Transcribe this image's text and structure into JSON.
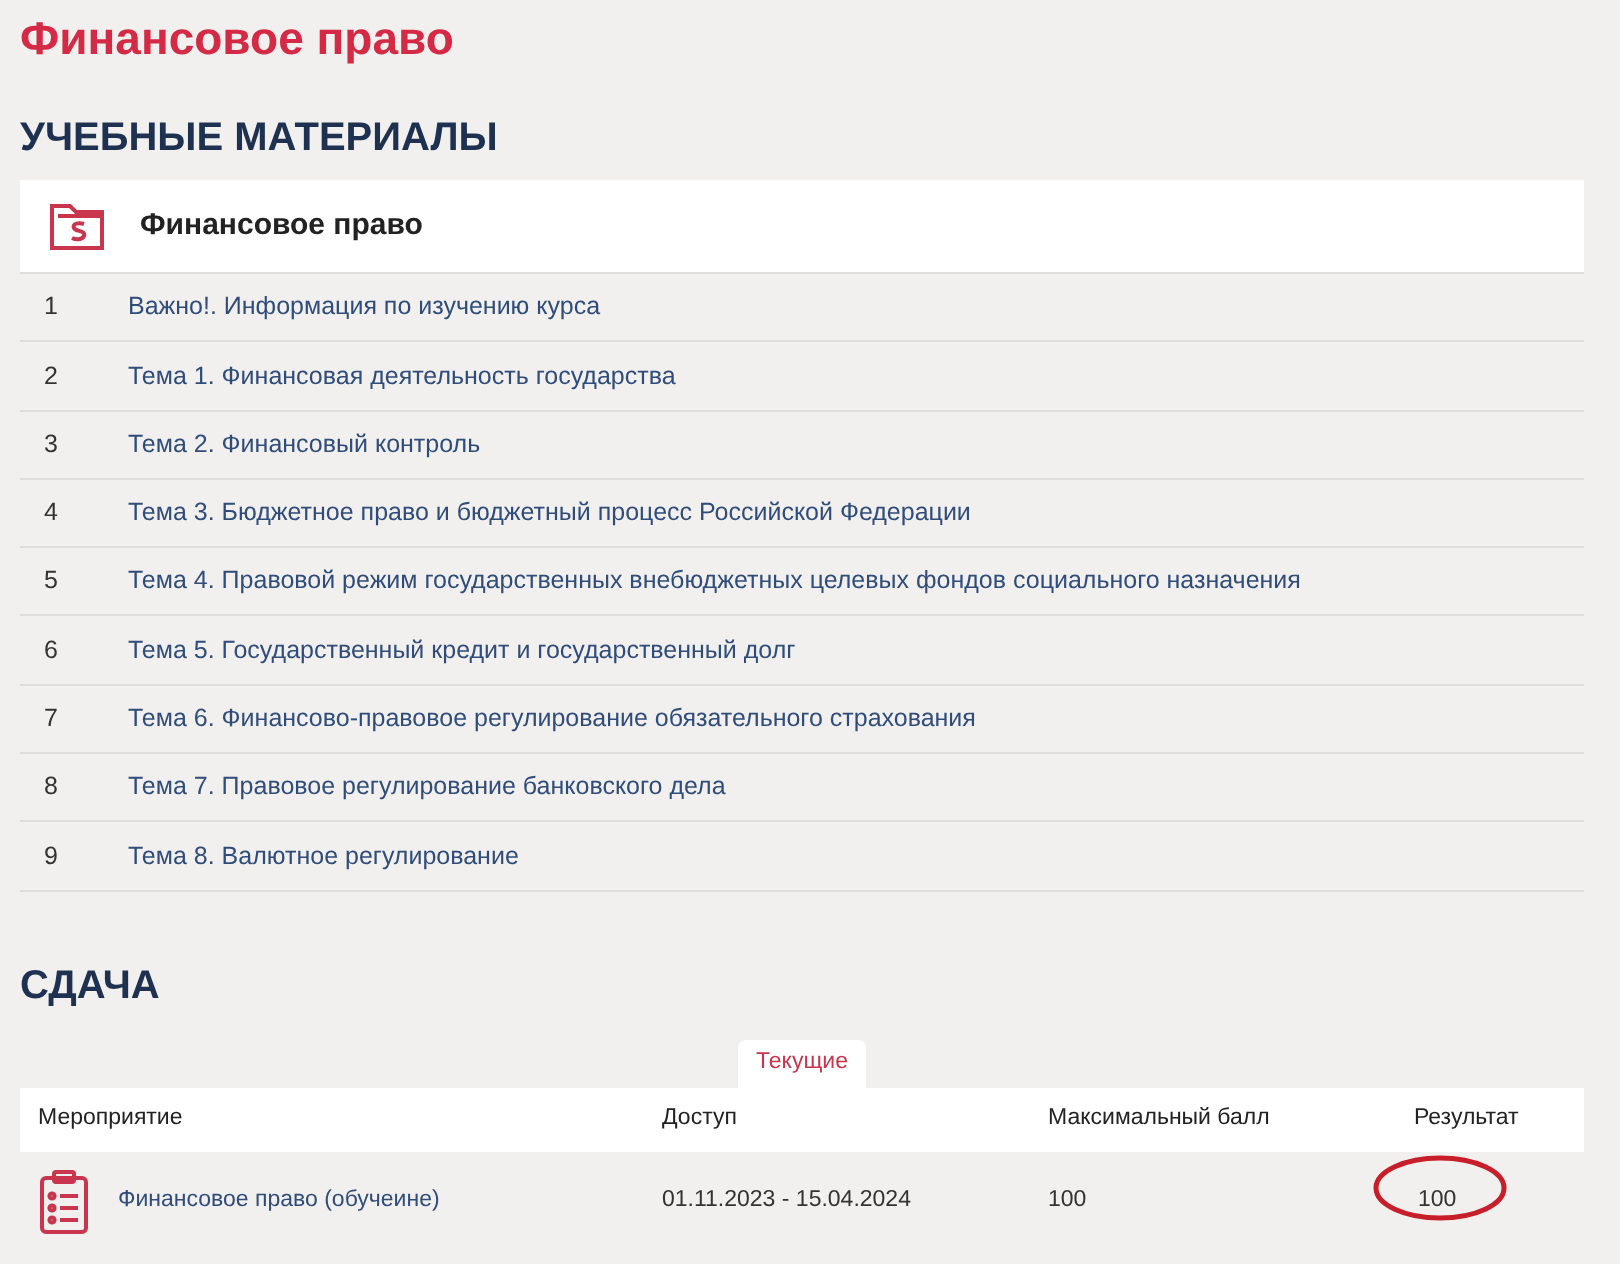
{
  "page_title": "Финансовое право",
  "materials": {
    "heading": "УЧЕБНЫЕ МАТЕРИАЛЫ",
    "course_title": "Финансовое право",
    "items": [
      {
        "number": "1",
        "title": "Важно!. Информация по изучению курса"
      },
      {
        "number": "2",
        "title": "Тема 1. Финансовая деятельность государства"
      },
      {
        "number": "3",
        "title": "Тема 2. Финансовый контроль"
      },
      {
        "number": "4",
        "title": "Тема 3. Бюджетное право и бюджетный процесс Российской Федерации"
      },
      {
        "number": "5",
        "title": "Тема 4. Правовой режим государственных внебюджетных целевых фондов социального назначения"
      },
      {
        "number": "6",
        "title": "Тема 5. Государственный кредит и государственный долг"
      },
      {
        "number": "7",
        "title": "Тема 6. Финансово-правовое регулирование обязательного страхования"
      },
      {
        "number": "8",
        "title": "Тема 7. Правовое регулирование банковского дела"
      },
      {
        "number": "9",
        "title": "Тема 8. Валютное регулирование"
      }
    ]
  },
  "submission": {
    "heading": "СДАЧА",
    "tabs": [
      {
        "label": "Текущие",
        "selected": true
      }
    ],
    "table": {
      "columns": [
        "Мероприятие",
        "Доступ",
        "Максимальный балл",
        "Результат"
      ],
      "rows": [
        {
          "event": "Финансовое право (обучеине)",
          "access": "01.11.2023 - 15.04.2024",
          "max_score": "100",
          "result": "100",
          "result_circled": true
        }
      ]
    }
  }
}
